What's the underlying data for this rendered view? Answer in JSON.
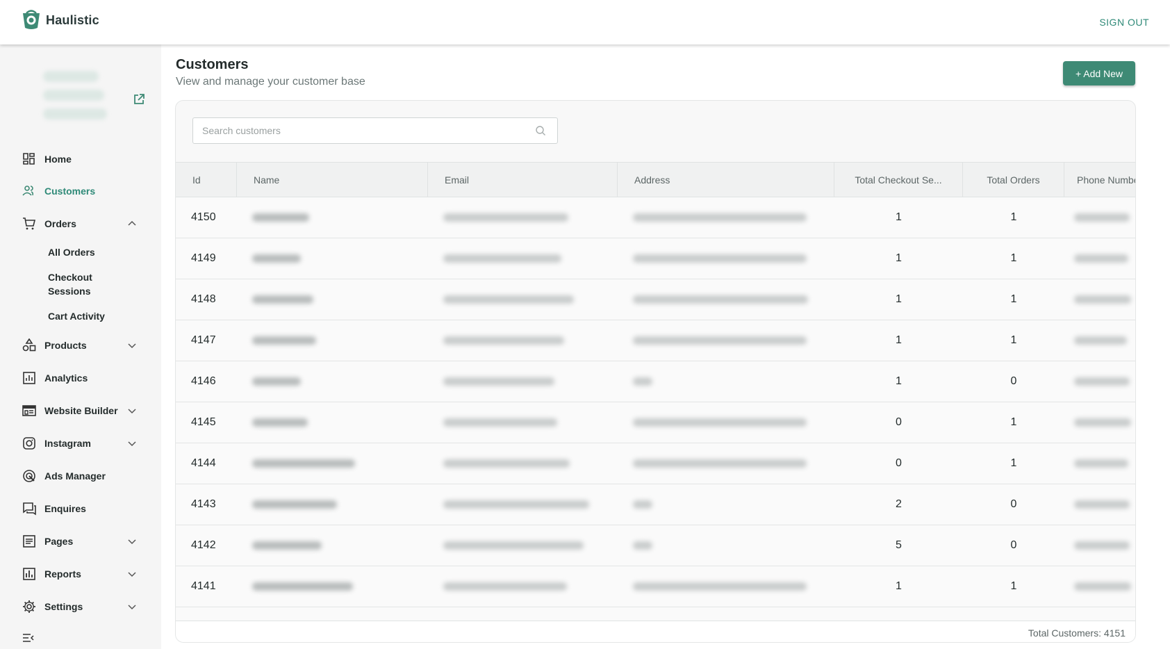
{
  "brand": {
    "name": "Haulistic",
    "accent": "#3e8a75"
  },
  "header": {
    "signout_label": "SIGN OUT"
  },
  "sidebar": {
    "items": [
      {
        "key": "home",
        "label": "Home",
        "icon": "dashboard-icon",
        "chevron": false,
        "active": false
      },
      {
        "key": "customers",
        "label": "Customers",
        "icon": "people-icon",
        "chevron": false,
        "active": true
      },
      {
        "key": "orders",
        "label": "Orders",
        "icon": "cart-icon",
        "chevron": "up",
        "active": false
      },
      {
        "key": "products",
        "label": "Products",
        "icon": "shapes-icon",
        "chevron": "down",
        "active": false
      },
      {
        "key": "analytics",
        "label": "Analytics",
        "icon": "analytics-icon",
        "chevron": false,
        "active": false
      },
      {
        "key": "website-builder",
        "label": "Website Builder",
        "icon": "web-icon",
        "chevron": "down",
        "active": false
      },
      {
        "key": "instagram",
        "label": "Instagram",
        "icon": "instagram-icon",
        "chevron": "down",
        "active": false
      },
      {
        "key": "ads-manager",
        "label": "Ads Manager",
        "icon": "ads-icon",
        "chevron": false,
        "active": false
      },
      {
        "key": "enquires",
        "label": "Enquires",
        "icon": "chat-icon",
        "chevron": false,
        "active": false
      },
      {
        "key": "pages",
        "label": "Pages",
        "icon": "page-icon",
        "chevron": "down",
        "active": false
      },
      {
        "key": "reports",
        "label": "Reports",
        "icon": "reports-icon",
        "chevron": "down",
        "active": false
      },
      {
        "key": "settings",
        "label": "Settings",
        "icon": "gear-icon",
        "chevron": "down",
        "active": false
      }
    ],
    "orders_sub": [
      "All Orders",
      "Checkout Sessions",
      "Cart Activity"
    ]
  },
  "main": {
    "title": "Customers",
    "subtitle": "View and manage your customer base",
    "add_button": "+ Add New",
    "search_placeholder": "Search customers",
    "columns": [
      "Id",
      "Name",
      "Email",
      "Address",
      "Total Checkout Se...",
      "Total Orders",
      "Phone Numbe"
    ],
    "rows": [
      {
        "id": "4150",
        "checkout": "1",
        "orders": "1"
      },
      {
        "id": "4149",
        "checkout": "1",
        "orders": "1"
      },
      {
        "id": "4148",
        "checkout": "1",
        "orders": "1"
      },
      {
        "id": "4147",
        "checkout": "1",
        "orders": "1"
      },
      {
        "id": "4146",
        "checkout": "1",
        "orders": "0"
      },
      {
        "id": "4145",
        "checkout": "0",
        "orders": "1"
      },
      {
        "id": "4144",
        "checkout": "0",
        "orders": "1"
      },
      {
        "id": "4143",
        "checkout": "2",
        "orders": "0"
      },
      {
        "id": "4142",
        "checkout": "5",
        "orders": "0"
      },
      {
        "id": "4141",
        "checkout": "1",
        "orders": "1"
      }
    ],
    "footer_total": "Total Customers: 4151"
  }
}
